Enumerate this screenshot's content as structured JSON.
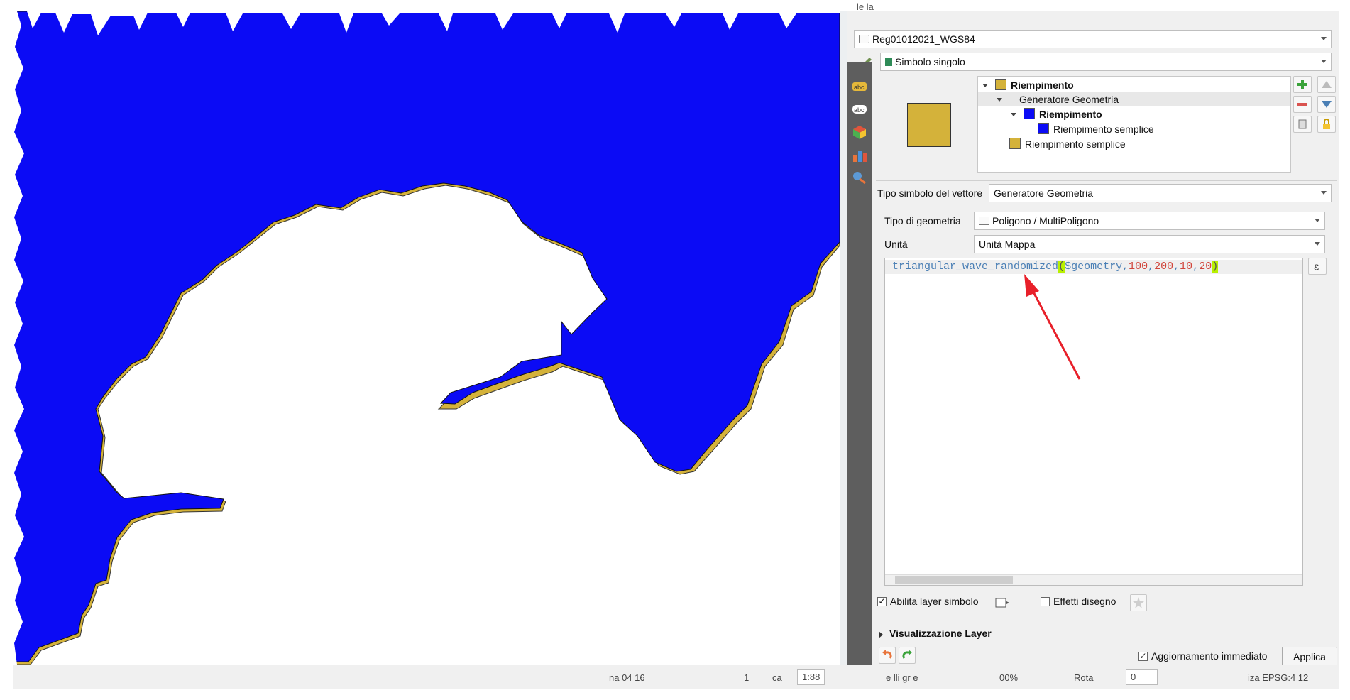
{
  "top_dock_partial": "le la",
  "layer_combo": {
    "value": "Reg01012021_WGS84",
    "partial_value": "Reg0101..."
  },
  "renderer_combo": {
    "value": "Simbolo singolo"
  },
  "symbol_tree": [
    {
      "label": "Riempimento",
      "bold": true,
      "color": "#d4b23a",
      "level": 0
    },
    {
      "label": "Generatore Geometria",
      "bold": false,
      "color": null,
      "level": 1
    },
    {
      "label": "Riempimento",
      "bold": true,
      "color": "#0b0bf5",
      "level": 2
    },
    {
      "label": "Riempimento semplice",
      "bold": false,
      "color": "#0b0bf5",
      "level": 3
    },
    {
      "label": "Riempimento semplice",
      "bold": false,
      "color": "#d4b23a",
      "level": 1
    }
  ],
  "symbol_type": {
    "label": "Tipo simbolo del vettore",
    "value": "Generatore Geometria"
  },
  "geometry_type": {
    "label": "Tipo di geometria",
    "value": "Poligono / MultiPoligono"
  },
  "units": {
    "label": "Unità",
    "value": "Unità Mappa"
  },
  "expression": {
    "fn": "triangular_wave_randomized",
    "open": "(",
    "var": "$geometry",
    "c1": ",",
    "n1": "100",
    "c2": ",",
    "n2": "200",
    "c3": ",",
    "n3": "10",
    "c4": ",",
    "n4": "20",
    "close": ")"
  },
  "enable_symbol_layer": {
    "label": "Abilita layer simbolo",
    "checked": true
  },
  "draw_effects": {
    "label": "Effetti disegno",
    "checked": false
  },
  "layer_rendering": {
    "label": "Visualizzazione Layer"
  },
  "live_update": {
    "label": "Aggiornamento immediato",
    "checked": true
  },
  "apply_button": "Applica",
  "status_bar": {
    "coord_partial": "na  04 16",
    "scale_partial": "1",
    "scale_label_partial": "ca",
    "scale_value_partial": "1:88",
    "magnifier_partial": "e  lli gr     e",
    "magnifier_value_partial": "00%",
    "rotation_label_partial": "Rota",
    "rotation_value_partial": "0",
    "crs_partial": "iza   EPSG:4 12"
  },
  "colors": {
    "blue_fill": "#0b0bf5",
    "gold_fill": "#d4b23a",
    "panel_bg": "#f0f0f0",
    "toolbar_dark": "#5e5e5e",
    "annotation_arrow": "#e8202a"
  }
}
